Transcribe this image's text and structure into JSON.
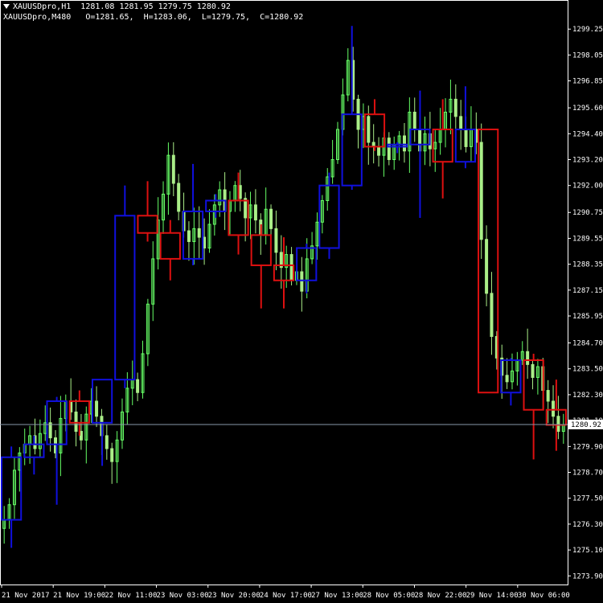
{
  "header": {
    "line1_symbol": "XAUUSDpro,H1",
    "line1_values": "1281.08 1281.95 1279.75 1280.92",
    "line2_symbol": "XAUUSDpro,M480",
    "line2_values": "O=1281.65,  H=1283.06,  L=1279.75,  C=1280.92"
  },
  "current_price_label": "1280.92",
  "colors": {
    "background": "#000000",
    "bull_h1": "#66ff66",
    "bear_h1": "#aaee88",
    "m480_bull": "#1010dd",
    "m480_bear": "#dd1010",
    "axis": "#ffffff",
    "price_line": "#8899aa"
  },
  "chart_data": {
    "type": "candlestick",
    "title": "",
    "xlabel": "",
    "ylabel": "",
    "ylim": [
      1273.5,
      1300.6
    ],
    "y_ticks": [
      "1299.25",
      "1298.05",
      "1296.85",
      "1295.60",
      "1294.40",
      "1293.20",
      "1292.00",
      "1290.75",
      "1289.55",
      "1288.35",
      "1287.15",
      "1285.95",
      "1284.70",
      "1283.50",
      "1282.30",
      "1281.10",
      "1279.90",
      "1278.70",
      "1277.50",
      "1276.30",
      "1275.10",
      "1273.90"
    ],
    "x_ticks": [
      "21 Nov 2017",
      "21 Nov 19:00",
      "22 Nov 11:00",
      "23 Nov 03:00",
      "23 Nov 20:00",
      "24 Nov 17:00",
      "27 Nov 13:00",
      "28 Nov 05:00",
      "28 Nov 22:00",
      "29 Nov 14:00",
      "30 Nov 06:00"
    ],
    "current_price": 1280.92,
    "h1_close_path": [
      1276.5,
      1277.2,
      1278.8,
      1279.6,
      1280.0,
      1280.4,
      1279.8,
      1280.5,
      1281.0,
      1280.3,
      1279.6,
      1281.2,
      1282.0,
      1281.5,
      1280.6,
      1280.2,
      1281.4,
      1282.0,
      1281.3,
      1280.4,
      1279.8,
      1279.2,
      1280.2,
      1281.5,
      1282.6,
      1283.0,
      1282.4,
      1284.2,
      1286.5,
      1288.6,
      1290.4,
      1291.6,
      1293.4,
      1292.1,
      1290.8,
      1289.9,
      1289.4,
      1290.0,
      1289.6,
      1289.1,
      1290.2,
      1291.1,
      1291.8,
      1290.8,
      1291.3,
      1292.0,
      1291.4,
      1290.5,
      1291.1,
      1290.4,
      1289.7,
      1290.9,
      1290.0,
      1288.9,
      1288.2,
      1288.8,
      1287.6,
      1288.0,
      1287.1,
      1288.6,
      1289.2,
      1290.3,
      1291.3,
      1292.4,
      1293.2,
      1294.6,
      1296.2,
      1297.8,
      1296.0,
      1294.6,
      1295.2,
      1294.0,
      1293.8,
      1293.4,
      1294.2,
      1293.2,
      1293.9,
      1294.3,
      1293.6,
      1295.4,
      1294.6,
      1293.6,
      1294.4,
      1293.7,
      1294.0,
      1294.6,
      1295.4,
      1296.0,
      1295.2,
      1294.6,
      1293.8,
      1294.6,
      1294.0,
      1289.5,
      1287.0,
      1285.0,
      1284.0,
      1283.2,
      1282.9,
      1283.4,
      1283.9,
      1284.3,
      1283.7,
      1283.1,
      1283.6,
      1282.5,
      1282.0,
      1281.3,
      1280.6,
      1280.9
    ],
    "series": [
      {
        "name": "",
        "timeframe": "M480",
        "candles": [
          {
            "o": 1276.5,
            "h": 1279.9,
            "l": 1275.2,
            "c": 1279.4
          },
          {
            "o": 1279.4,
            "h": 1280.4,
            "l": 1278.6,
            "c": 1280.0
          },
          {
            "o": 1280.0,
            "h": 1282.2,
            "l": 1277.2,
            "c": 1282.0
          },
          {
            "o": 1282.0,
            "h": 1282.5,
            "l": 1280.4,
            "c": 1281.0
          },
          {
            "o": 1281.0,
            "h": 1283.0,
            "l": 1279.0,
            "c": 1283.0
          },
          {
            "o": 1283.0,
            "h": 1292.0,
            "l": 1282.6,
            "c": 1290.6
          },
          {
            "o": 1290.6,
            "h": 1292.2,
            "l": 1289.4,
            "c": 1289.8
          },
          {
            "o": 1289.8,
            "h": 1290.4,
            "l": 1287.6,
            "c": 1288.6
          },
          {
            "o": 1288.6,
            "h": 1293.0,
            "l": 1288.3,
            "c": 1290.8
          },
          {
            "o": 1290.8,
            "h": 1291.6,
            "l": 1290.5,
            "c": 1291.3
          },
          {
            "o": 1291.3,
            "h": 1292.6,
            "l": 1288.8,
            "c": 1289.7
          },
          {
            "o": 1289.7,
            "h": 1290.2,
            "l": 1286.3,
            "c": 1288.3
          },
          {
            "o": 1288.3,
            "h": 1289.6,
            "l": 1286.3,
            "c": 1287.6
          },
          {
            "o": 1287.6,
            "h": 1289.3,
            "l": 1287.0,
            "c": 1289.1
          },
          {
            "o": 1289.1,
            "h": 1292.6,
            "l": 1288.6,
            "c": 1292.0
          },
          {
            "o": 1292.0,
            "h": 1299.4,
            "l": 1291.8,
            "c": 1295.3
          },
          {
            "o": 1295.3,
            "h": 1296.0,
            "l": 1293.6,
            "c": 1293.8
          },
          {
            "o": 1293.8,
            "h": 1294.0,
            "l": 1293.5,
            "c": 1293.9
          },
          {
            "o": 1293.9,
            "h": 1296.4,
            "l": 1290.5,
            "c": 1294.6
          },
          {
            "o": 1294.6,
            "h": 1296.0,
            "l": 1291.4,
            "c": 1293.1
          },
          {
            "o": 1293.1,
            "h": 1296.6,
            "l": 1292.8,
            "c": 1294.6
          },
          {
            "o": 1294.6,
            "h": 1294.6,
            "l": 1282.4,
            "c": 1282.4
          },
          {
            "o": 1282.4,
            "h": 1284.0,
            "l": 1281.8,
            "c": 1283.9
          },
          {
            "o": 1283.9,
            "h": 1284.2,
            "l": 1279.3,
            "c": 1281.6
          },
          {
            "o": 1281.6,
            "h": 1283.0,
            "l": 1279.7,
            "c": 1280.9
          }
        ]
      }
    ]
  }
}
